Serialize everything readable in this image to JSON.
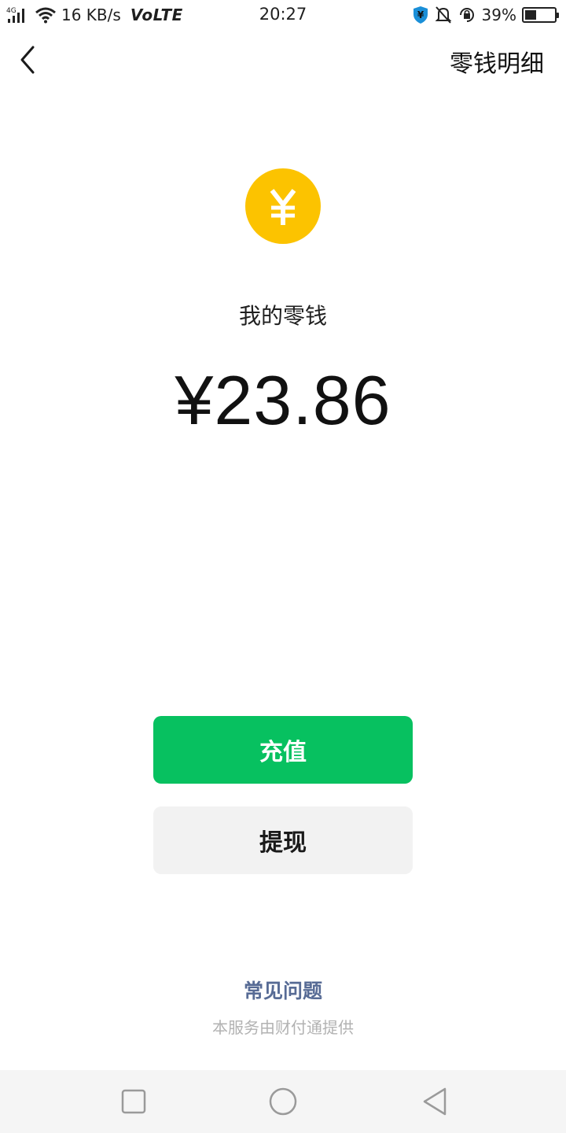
{
  "status_bar": {
    "network_type": "4G",
    "speed": "16 KB/s",
    "volte": "VoLTE",
    "time": "20:27",
    "battery_percent": "39%",
    "battery_level": 0.39,
    "icons": [
      "signal-icon",
      "wifi-icon",
      "shield-yen-icon",
      "bell-off-icon",
      "rotation-lock-icon",
      "battery-icon"
    ]
  },
  "nav": {
    "back_icon": "chevron-left-icon",
    "title": "零钱明细"
  },
  "wallet": {
    "coin_icon": "yen-coin-icon",
    "coin_symbol": "¥",
    "label": "我的零钱",
    "amount": "¥23.86"
  },
  "actions": {
    "recharge_label": "充值",
    "withdraw_label": "提现"
  },
  "footer": {
    "faq_label": "常见问题",
    "provider_text": "本服务由财付通提供"
  },
  "colors": {
    "accent_green": "#07c160",
    "coin_yellow": "#fcc300",
    "link_blue": "#576b95",
    "muted_gray": "#b2b2b2"
  },
  "system_nav": {
    "icons": [
      "square-recent-icon",
      "circle-home-icon",
      "triangle-back-icon"
    ]
  }
}
